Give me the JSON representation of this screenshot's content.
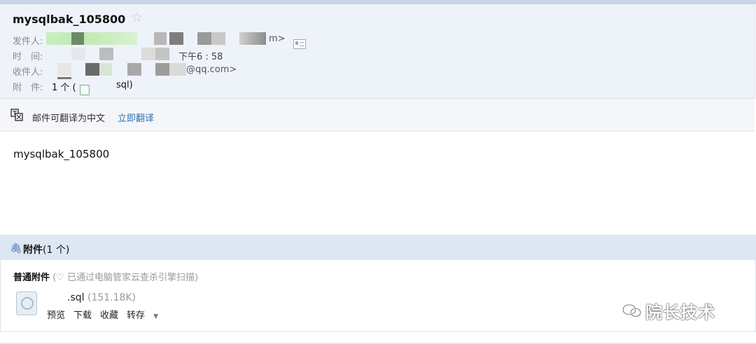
{
  "email": {
    "subject": "mysqlbak_105800",
    "star_icon": "star-icon",
    "sender_label": "发件人:",
    "sender_tail": "m>",
    "time_label": "时　间:",
    "time_value": "下午6 : 58",
    "recipient_label": "收件人:",
    "recipient_tail": "@qq.com>",
    "attachment_label": "附　件:",
    "attachment_count": "1 个 (",
    "attachment_name_tail": "sql)"
  },
  "translate": {
    "text": "邮件可翻译为中文",
    "link": "立即翻译"
  },
  "body": {
    "text": "mysqlbak_105800"
  },
  "attachments": {
    "title_bold": "附件",
    "title_count": "(1 个)",
    "section_label": "普通附件",
    "scan_note": "(♡ 已通过电脑管家云查杀引擎扫描)",
    "file": {
      "name": ".sql",
      "size": "(151.18K)"
    },
    "actions": {
      "preview": "预览",
      "download": "下载",
      "favorite": "收藏",
      "forward": "转存",
      "forward_caret": "▼"
    }
  },
  "watermark": {
    "text": "院长技术"
  },
  "colors": {
    "header_bg": "#eef3fa",
    "link": "#2f6fb8",
    "attachment_header_bg": "#dde7f3"
  }
}
